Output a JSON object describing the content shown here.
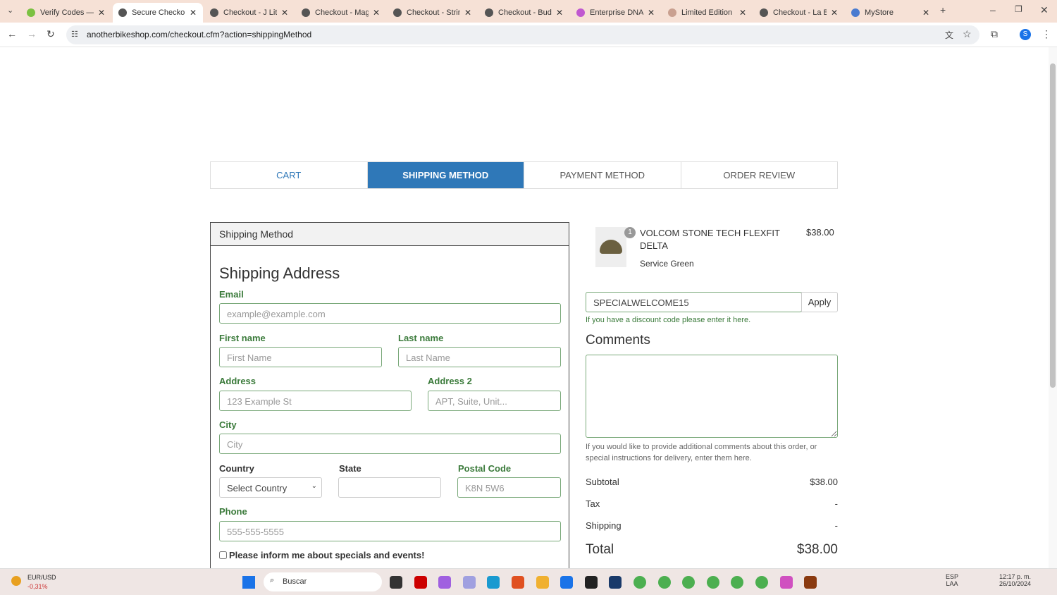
{
  "browser": {
    "tabs": [
      {
        "title": "Verify Codes — Si",
        "icon": "#7bc142"
      },
      {
        "title": "Secure Checkout",
        "icon": "#555",
        "active": true
      },
      {
        "title": "Checkout - J Litty",
        "icon": "#555"
      },
      {
        "title": "Checkout - Magn",
        "icon": "#555"
      },
      {
        "title": "Checkout - String",
        "icon": "#555"
      },
      {
        "title": "Checkout - Buddh",
        "icon": "#555"
      },
      {
        "title": "Enterprise DNA: N",
        "icon": "#c058d0"
      },
      {
        "title": "Limited Edition M",
        "icon": "#c9a090"
      },
      {
        "title": "Checkout - La Boh",
        "icon": "#555"
      },
      {
        "title": "MyStore",
        "icon": "#4a7bd0"
      }
    ],
    "url": "anotherbikeshop.com/checkout.cfm?action=shippingMethod",
    "profile": "S"
  },
  "steps": [
    "CART",
    "SHIPPING METHOD",
    "PAYMENT METHOD",
    "ORDER REVIEW"
  ],
  "panel": {
    "header": "Shipping Method",
    "title": "Shipping Address",
    "email_label": "Email",
    "email_ph": "example@example.com",
    "first_label": "First name",
    "first_ph": "First Name",
    "last_label": "Last name",
    "last_ph": "Last Name",
    "addr_label": "Address",
    "addr_ph": "123 Example St",
    "addr2_label": "Address 2",
    "addr2_ph": "APT, Suite, Unit...",
    "city_label": "City",
    "city_ph": "City",
    "country_label": "Country",
    "country_value": "Select Country",
    "state_label": "State",
    "postal_label": "Postal Code",
    "postal_ph": "K8N 5W6",
    "phone_label": "Phone",
    "phone_ph": "555-555-5555",
    "newsletter": "Please inform me about specials and events!"
  },
  "cart": {
    "qty": "1",
    "name": "VOLCOM STONE TECH FLEXFIT DELTA",
    "variant": "Service Green",
    "price": "$38.00",
    "discount_value": "SPECIALWELCOME15",
    "apply": "Apply",
    "discount_help": "If you have a discount code please enter it here.",
    "comments_title": "Comments",
    "comments_help": "If you would like to provide additional comments about this order, or special instructions for delivery, enter them here.",
    "subtotal_label": "Subtotal",
    "subtotal": "$38.00",
    "tax_label": "Tax",
    "tax": "-",
    "shipping_label": "Shipping",
    "shipping": "-",
    "total_label": "Total",
    "total": "$38.00"
  },
  "taskbar": {
    "ticker": "EUR/USD",
    "change": "-0,31%",
    "search": "Buscar",
    "lang1": "ESP",
    "lang2": "LAA",
    "time": "12:17 p. m.",
    "date": "26/10/2024"
  }
}
